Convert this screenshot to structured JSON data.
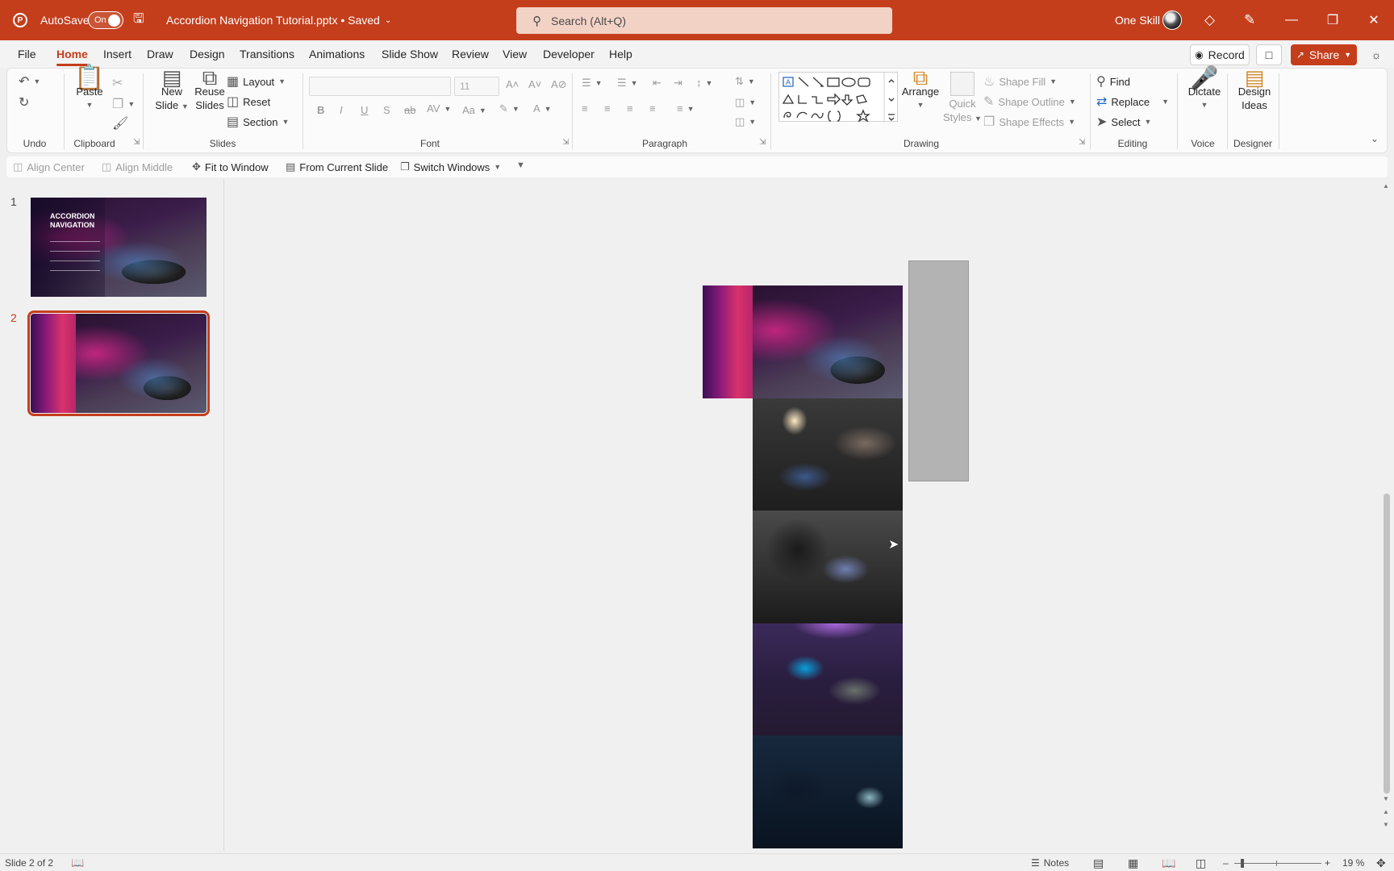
{
  "titlebar": {
    "autosave_label": "AutoSave",
    "autosave_state": "On",
    "doc_title": "Accordion Navigation Tutorial.pptx • Saved",
    "search_placeholder": "Search (Alt+Q)",
    "user_name": "One Skill",
    "accent_color": "#c43e1c"
  },
  "tabs": [
    "File",
    "Home",
    "Insert",
    "Draw",
    "Design",
    "Transitions",
    "Animations",
    "Slide Show",
    "Review",
    "View",
    "Developer",
    "Help"
  ],
  "active_tab": "Home",
  "tab_actions": {
    "record": "Record",
    "share": "Share"
  },
  "ribbon": {
    "groups": {
      "undo": "Undo",
      "clipboard": "Clipboard",
      "slides": "Slides",
      "font": "Font",
      "paragraph": "Paragraph",
      "drawing": "Drawing",
      "editing": "Editing",
      "voice": "Voice",
      "designer": "Designer"
    },
    "paste": "Paste",
    "new_slide": [
      "New",
      "Slide"
    ],
    "reuse_slides": [
      "Reuse",
      "Slides"
    ],
    "layout": "Layout",
    "reset": "Reset",
    "section": "Section",
    "font_size": "11",
    "arrange": "Arrange",
    "quick_styles": [
      "Quick",
      "Styles"
    ],
    "shape_fill": "Shape Fill",
    "shape_outline": "Shape Outline",
    "shape_effects": "Shape Effects",
    "find": "Find",
    "replace": "Replace",
    "select": "Select",
    "dictate": "Dictate",
    "design_ideas": [
      "Design",
      "Ideas"
    ]
  },
  "quick_access": {
    "align_center": "Align Center",
    "align_middle": "Align Middle",
    "fit_to_window": "Fit to Window",
    "from_current_slide": "From Current Slide",
    "switch_windows": "Switch Windows"
  },
  "thumbnails": [
    {
      "number": "1",
      "title_line1": "ACCORDION",
      "title_line2": "NAVIGATION",
      "selected": false
    },
    {
      "number": "2",
      "selected": true
    }
  ],
  "statusbar": {
    "slide_info": "Slide 2 of 2",
    "notes": "Notes",
    "zoom": "19 %"
  }
}
